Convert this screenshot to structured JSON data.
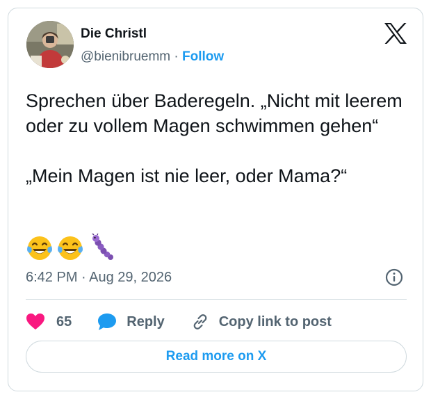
{
  "author": {
    "name": "Die Christl",
    "handle": "@bienibruemm",
    "separator": " · ",
    "follow_label": "Follow"
  },
  "tweet": {
    "paragraphs": [
      "Sprechen über Baderegeln. „Nicht mit leerem oder zu vollem Magen schwimmen gehen“",
      "„Mein Magen ist nie leer, oder Mama?“"
    ],
    "emojis": [
      "face-with-tears-of-joy",
      "face-with-tears-of-joy",
      "bug"
    ],
    "timestamp": "6:42 PM · Aug 29, 2026"
  },
  "actions": {
    "like_count": "65",
    "reply_label": "Reply",
    "copy_label": "Copy link to post"
  },
  "read_more_label": "Read more on X",
  "colors": {
    "accent": "#1d9bf0",
    "like": "#f91880",
    "text": "#0f1419",
    "secondary": "#536471",
    "border": "#cfd9de"
  }
}
